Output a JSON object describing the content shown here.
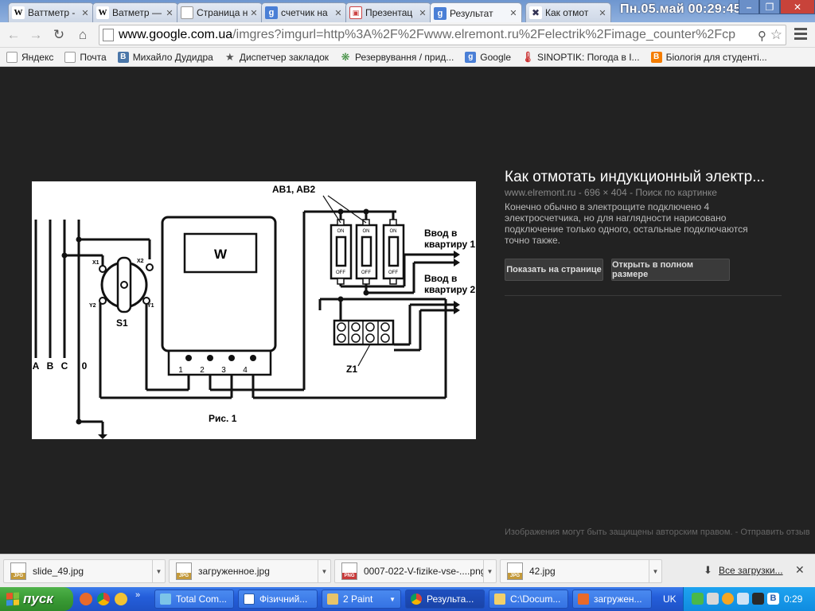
{
  "browser": {
    "tabs": [
      {
        "title": "Ваттметр -",
        "icon": "wikipedia-icon"
      },
      {
        "title": "Ватметр —",
        "icon": "wikipedia-icon"
      },
      {
        "title": "Страница н",
        "icon": "page-icon"
      },
      {
        "title": "счетчик на",
        "icon": "google-icon"
      },
      {
        "title": "Презентац",
        "icon": "slides-icon"
      },
      {
        "title": "Результат",
        "icon": "google-icon",
        "active": true
      },
      {
        "title": "Как отмот",
        "icon": "tools-icon"
      }
    ],
    "clock": "Пн.05.май 00:29:45",
    "address": {
      "host": "www.google.com.ua",
      "path": "/imgres?imgurl=http%3A%2F%2Fwww.elremont.ru%2Felectrik%2Fimage_counter%2Fcp"
    }
  },
  "bookmarks": [
    {
      "label": "Яндекс",
      "icon": "page-icon"
    },
    {
      "label": "Почта",
      "icon": "page-icon"
    },
    {
      "label": "Михайло Дудидра",
      "icon": "vk-icon"
    },
    {
      "label": "Диспетчер закладок",
      "icon": "star-icon"
    },
    {
      "label": "Резервування / прид...",
      "icon": "site-icon"
    },
    {
      "label": "Google",
      "icon": "google-icon"
    },
    {
      "label": "SINOPTIK: Погода в I...",
      "icon": "thermometer-icon"
    },
    {
      "label": "Біологія для студенті...",
      "icon": "blogger-icon"
    }
  ],
  "image_panel": {
    "title": "Как отмотать индукционный электр...",
    "meta": "www.elremont.ru - 696 × 404 - Поиск по картинке",
    "description": "Конечно обычно в электрощите подключено 4 электросчетчика, но для наглядности нарисовано подключение только одного, остальные подключаются точно также.",
    "btn_show": "Показать на странице",
    "btn_full": "Открыть в полном размере",
    "footer": "Изображения могут быть защищены авторским правом. - Отправить отзыв"
  },
  "diagram": {
    "label_ab": "AB1, AB2",
    "label_in1a": "Ввод в",
    "label_in1b": "квартиру 1",
    "label_in2a": "Ввод в",
    "label_in2b": "квартиру 2",
    "label_w": "W",
    "label_s1": "S1",
    "label_z1": "Z1",
    "label_fig": "Рис. 1",
    "label_a": "A",
    "label_b": "B",
    "label_c": "C",
    "label_0": "0",
    "label_x1": "X1",
    "label_x2": "X2",
    "label_y1": "Y1",
    "label_y2": "Y2",
    "t1": "1",
    "t2": "2",
    "t3": "3",
    "t4": "4",
    "on": "ON",
    "off": "OFF"
  },
  "downloads": {
    "items": [
      {
        "name": "slide_49.jpg",
        "type": "JPG"
      },
      {
        "name": "загруженное.jpg",
        "type": "JPG"
      },
      {
        "name": "0007-022-V-fizike-vse-....png",
        "type": "PNG"
      },
      {
        "name": "42.jpg",
        "type": "JPG"
      }
    ],
    "all_label": "Все загрузки..."
  },
  "taskbar": {
    "start": "пуск",
    "tasks": [
      {
        "label": "Total Com..."
      },
      {
        "label": "Фізичний..."
      },
      {
        "label": "2 Paint"
      },
      {
        "label": "Результа...",
        "active": true
      },
      {
        "label": "C:\\Docum..."
      },
      {
        "label": "загружен..."
      }
    ],
    "lang": "UK",
    "time": "0:29"
  }
}
